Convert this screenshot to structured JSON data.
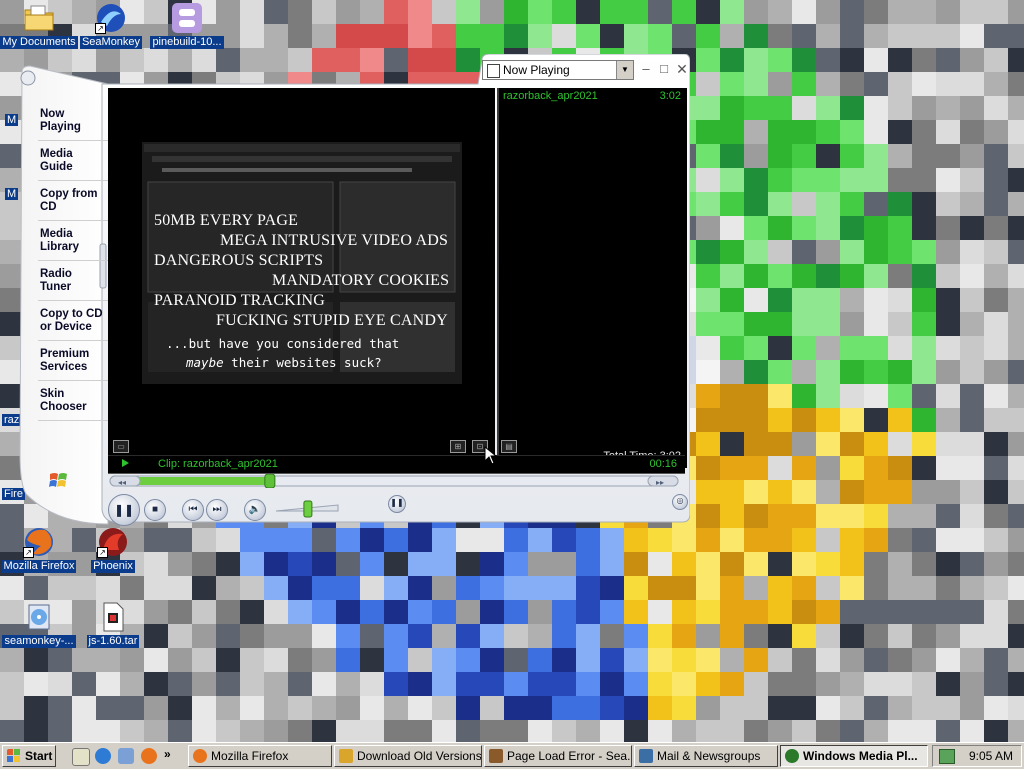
{
  "desktop": {
    "icons": [
      {
        "label": "My Documents",
        "icon": "folder-documents-icon"
      },
      {
        "label": "SeaMonkey",
        "icon": "seamonkey-icon"
      },
      {
        "label": "pinebuild-10...",
        "icon": "pinebuild-icon"
      },
      {
        "label": "Mozilla Firefox",
        "icon": "firefox-icon"
      },
      {
        "label": "Phoenix",
        "icon": "phoenix-icon"
      },
      {
        "label": "seamonkey-...",
        "icon": "installer-icon"
      },
      {
        "label": "js-1.60.tar",
        "icon": "archive-icon"
      }
    ],
    "partial_labels": [
      "M",
      "M",
      "raz",
      "Fire"
    ]
  },
  "player": {
    "view_selector": "Now Playing",
    "tasks": [
      {
        "line1": "Now",
        "line2": "Playing",
        "has_arrow": true
      },
      {
        "line1": "Media",
        "line2": "Guide",
        "has_arrow": false
      },
      {
        "line1": "Copy from",
        "line2": "CD",
        "has_arrow": false
      },
      {
        "line1": "Media",
        "line2": "Library",
        "has_arrow": false
      },
      {
        "line1": "Radio",
        "line2": "Tuner",
        "has_arrow": false
      },
      {
        "line1": "Copy to CD",
        "line2": "or Device",
        "has_arrow": false
      },
      {
        "line1": "Premium",
        "line2": "Services",
        "has_arrow": true
      },
      {
        "line1": "Skin",
        "line2": "Chooser",
        "has_arrow": false
      }
    ],
    "video_text": {
      "lines": [
        "50MB EVERY PAGE",
        "MEGA INTRUSIVE VIDEO ADS",
        "DANGEROUS SCRIPTS",
        "MANDATORY COOKIES",
        "PARANOID TRACKING",
        "FUCKING STUPID EYE CANDY"
      ],
      "tagline_1": "...but have you considered that",
      "tagline_2_em": "maybe",
      "tagline_2_rest": " their websites suck?"
    },
    "playlist": {
      "items": [
        {
          "title": "razorback_apr2021",
          "duration": "3:02"
        }
      ],
      "total_time": "Total Time: 3:02"
    },
    "status": {
      "clip": "Clip: razorback_apr2021",
      "time": "00:16"
    },
    "seek_progress": 0.27,
    "volume_level": 0.55
  },
  "taskbar": {
    "start_label": "Start",
    "buttons": [
      {
        "label": "Mozilla Firefox",
        "active": false,
        "color": "#e8731c"
      },
      {
        "label": "Download Old Versions...",
        "active": false,
        "color": "#d9a52a"
      },
      {
        "label": "Page Load Error - Sea...",
        "active": false,
        "color": "#8a5a2b"
      },
      {
        "label": "Mail & Newsgroups",
        "active": false,
        "color": "#3a6ea5"
      },
      {
        "label": "Windows Media Pl...",
        "active": true,
        "color": "#2a7a2a"
      }
    ],
    "clock": "9:05 AM"
  }
}
